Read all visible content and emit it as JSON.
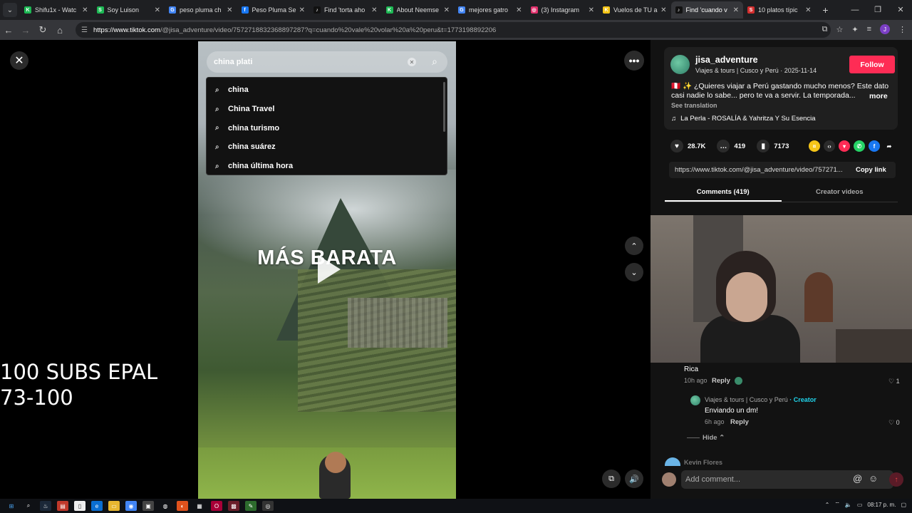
{
  "browser": {
    "tabs": [
      {
        "title": "Shifu1x - Watc",
        "color": "#1db954",
        "glyph": "K"
      },
      {
        "title": "Soy Luison",
        "color": "#1db954",
        "glyph": "S"
      },
      {
        "title": "peso pluma ch",
        "color": "#4285f4",
        "glyph": "G"
      },
      {
        "title": "Peso Pluma Se",
        "color": "#1877f2",
        "glyph": "f"
      },
      {
        "title": "Find 'torta aho",
        "color": "#111111",
        "glyph": "♪"
      },
      {
        "title": "About Neemse",
        "color": "#1db954",
        "glyph": "K"
      },
      {
        "title": "mejores gatro",
        "color": "#4285f4",
        "glyph": "G"
      },
      {
        "title": "(3) Instagram",
        "color": "#e1306c",
        "glyph": "◎"
      },
      {
        "title": "Vuelos de TU a",
        "color": "#f5c518",
        "glyph": "K"
      },
      {
        "title": "Find 'cuando v",
        "color": "#111111",
        "glyph": "♪",
        "active": true
      },
      {
        "title": "10 platos típic",
        "color": "#d32f2f",
        "glyph": "S"
      }
    ],
    "close_glyph": "✕",
    "new_tab_glyph": "+",
    "url_host": "https://www.tiktok.com",
    "url_path": "/@jisa_adventure/video/7572718832368897287?q=cuando%20vale%20volar%20a%20peru&t=1773198892206",
    "profile_initial": "J"
  },
  "overlay_text": {
    "line1": "100 SUBS EPAL",
    "line2": "73-100"
  },
  "search": {
    "value": "china plati",
    "suggestions": [
      "china",
      "China Travel",
      "china turismo",
      "china suárez",
      "china última hora"
    ]
  },
  "video": {
    "caption": "MÁS BARATA"
  },
  "author": {
    "handle": "jisa_adventure",
    "subtitle": "Viajes & tours | Cusco y Perú · 2025-11-14",
    "follow_label": "Follow",
    "description": "🇵🇪 ✨ ¿Quieres viajar a Perú gastando mucho menos? Este dato casi nadie lo sabe... pero te va a servir. La temporada...",
    "more_label": "more",
    "see_translation": "See translation",
    "music": "La Perla - ROSALÍA & Yahritza Y Su Esencia"
  },
  "stats": {
    "likes": "28.7K",
    "comments": "419",
    "saves": "7173"
  },
  "share_icons": [
    {
      "name": "coin",
      "color": "#f5c518",
      "glyph": "¤"
    },
    {
      "name": "embed",
      "color": "#2b2b2b",
      "glyph": "‹›"
    },
    {
      "name": "send",
      "color": "#fe2c55",
      "glyph": "▾"
    },
    {
      "name": "whatsapp",
      "color": "#25d366",
      "glyph": "✆"
    },
    {
      "name": "facebook",
      "color": "#1877f2",
      "glyph": "f"
    },
    {
      "name": "share",
      "color": "#121212",
      "glyph": "➦"
    }
  ],
  "link": {
    "url": "https://www.tiktok.com/@jisa_adventure/video/757271...",
    "copy_label": "Copy link"
  },
  "panel_tabs": {
    "comments": "Comments (419)",
    "creator_videos": "Creator videos"
  },
  "comments": [
    {
      "text": "Rica",
      "time": "10h ago",
      "reply": "Reply",
      "likes": "1"
    }
  ],
  "creator_reply": {
    "author": "Viajes & tours | Cusco y Perú",
    "badge": "· Creator",
    "text": "Enviando un dm!",
    "time": "6h ago",
    "reply": "Reply",
    "likes": "0"
  },
  "hide_label": "Hide",
  "next_commenter": "Kevin Flores",
  "comment_input": {
    "placeholder": "Add comment..."
  },
  "taskbar": {
    "clock": "08:17 p. m."
  }
}
